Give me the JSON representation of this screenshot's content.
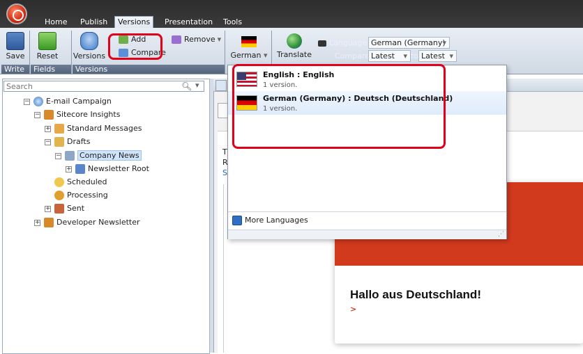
{
  "ribbon": {
    "tabs": [
      "Home",
      "Publish",
      "Versions",
      "Presentation",
      "Tools"
    ],
    "active_tab": "Versions",
    "save_label": "Save",
    "reset_label": "Reset",
    "versions_label": "Versions",
    "add_label": "Add",
    "compare_label": "Compare",
    "remove_label": "Remove",
    "language_button_label": "German",
    "translate_label": "Translate",
    "language_label": "Language",
    "language_value": "German (Germany)",
    "compare_field_label": "Compare",
    "compare_value": "Latest",
    "to_label": "to",
    "to_value": "Latest",
    "groups": [
      "Write",
      "Fields",
      "Versions"
    ]
  },
  "search": {
    "placeholder": "Search"
  },
  "tree": {
    "items": [
      {
        "label": "E-mail Campaign",
        "icon": "globe-icon"
      },
      {
        "label": "Sitecore Insights",
        "icon": "users-icon"
      },
      {
        "label": "Standard Messages",
        "icon": "folder-icon"
      },
      {
        "label": "Drafts",
        "icon": "folder-icon"
      },
      {
        "label": "Company News",
        "icon": "envelope-icon"
      },
      {
        "label": "Newsletter Root",
        "icon": "tree-icon"
      },
      {
        "label": "Scheduled",
        "icon": "clock-icon"
      },
      {
        "label": "Processing",
        "icon": "gears-icon"
      },
      {
        "label": "Sent",
        "icon": "sent-icon"
      },
      {
        "label": "Developer Newsletter",
        "icon": "users-icon"
      }
    ]
  },
  "dropdown": {
    "items": [
      {
        "title": "English : English",
        "sub": "1 version.",
        "flag": "us-flag"
      },
      {
        "title": "German (Germany) : Deutsch (Deutschland)",
        "sub": "1 version.",
        "flag": "de-flag"
      }
    ],
    "more_label": "More Languages"
  },
  "content": {
    "t_label": "T",
    "r_label": "R",
    "s_label": "S",
    "heading": "Hallo aus Deutschland!",
    "link_marker": ">"
  },
  "colors": {
    "highlight": "#e3001b",
    "banner": "#d23a1e"
  }
}
